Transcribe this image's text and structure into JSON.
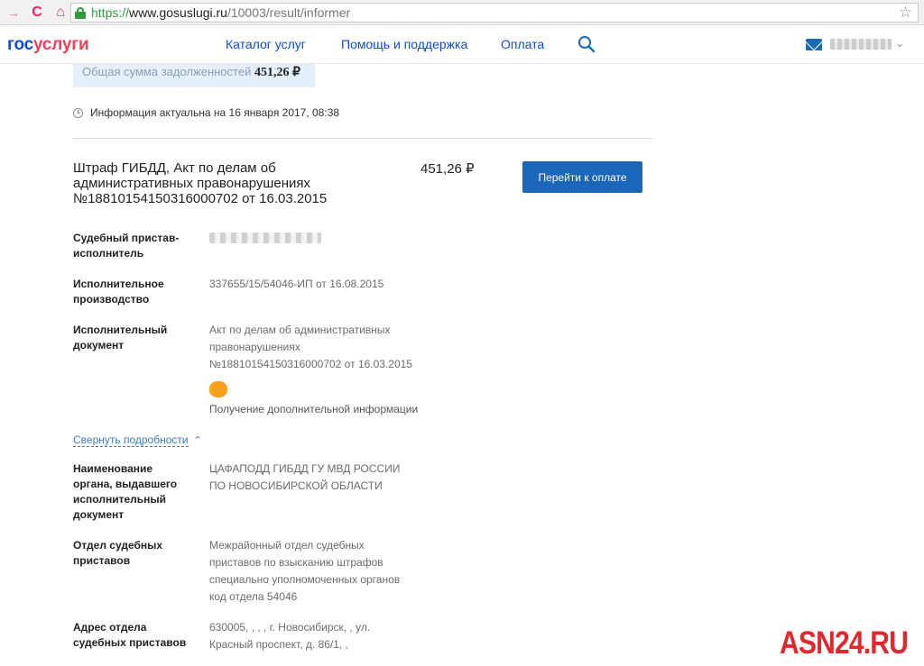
{
  "browser": {
    "url_https": "https://",
    "url_host": "www.gosuslugi.ru",
    "url_path": "/10003/result/informer",
    "back_glyph": "→",
    "reload_glyph": "C",
    "home_glyph": "⌂",
    "star_glyph": "☆"
  },
  "header": {
    "logo_part1": "гос",
    "logo_part2": "услуги",
    "nav": [
      "Каталог услуг",
      "Помощь и поддержка",
      "Оплата"
    ],
    "chevron_glyph": "⌄"
  },
  "debt": {
    "label": "Общая сумма задолженностей",
    "amount": "451,26 ₽"
  },
  "info": {
    "text": "Информация актуальна на 16 января 2017, 08:38"
  },
  "fine": {
    "title_lines": [
      "Штраф ГИБДД, Акт по делам об",
      "административных правонарушениях",
      "№18810154150316000702 от 16.03.2015"
    ],
    "amount": "451,26 ₽",
    "pay_label": "Перейти к оплате"
  },
  "details": {
    "bailiff_label": [
      "Судебный пристав-",
      "исполнитель"
    ],
    "proceedings_label": [
      "Исполнительное",
      "производство"
    ],
    "proceedings_value": "337655/15/54046-ИП от 16.08.2015",
    "document_label": [
      "Исполнительный",
      "документ"
    ],
    "document_value": [
      "Акт по делам об административных",
      "правонарушениях",
      "№18810154150316000702 от 16.03.2015"
    ],
    "more_info": "Получение дополнительной информации",
    "collapse_label": "Свернуть подробности",
    "collapse_glyph": "⌃",
    "issuer_label": [
      "Наименование",
      "органа, выдавшего",
      "исполнительный",
      "документ"
    ],
    "issuer_value": [
      "ЦАФАПОДД ГИБДД ГУ МВД РОССИИ",
      "ПО НОВОСИБИРСКОЙ ОБЛАСТИ"
    ],
    "department_label": [
      "Отдел судебных",
      "приставов"
    ],
    "department_value": [
      "Межрайонный отдел судебных",
      "приставов по взысканию штрафов",
      "специально уполномоченных органов",
      "код отдела 54046"
    ],
    "address_label": [
      "Адрес отдела",
      "судебных приставов"
    ],
    "address_value": [
      "630005, , , , г. Новосибирск, , ул.",
      "Красный проспект, д. 86/1, ,"
    ]
  },
  "watermark": "ASN24.RU",
  "colors": {
    "brand_blue": "#0d4cd3",
    "brand_red": "#ee3f58",
    "button_blue": "#1b66b8",
    "accent_orange": "#f7a11a",
    "watermark_red": "#e0282e"
  }
}
